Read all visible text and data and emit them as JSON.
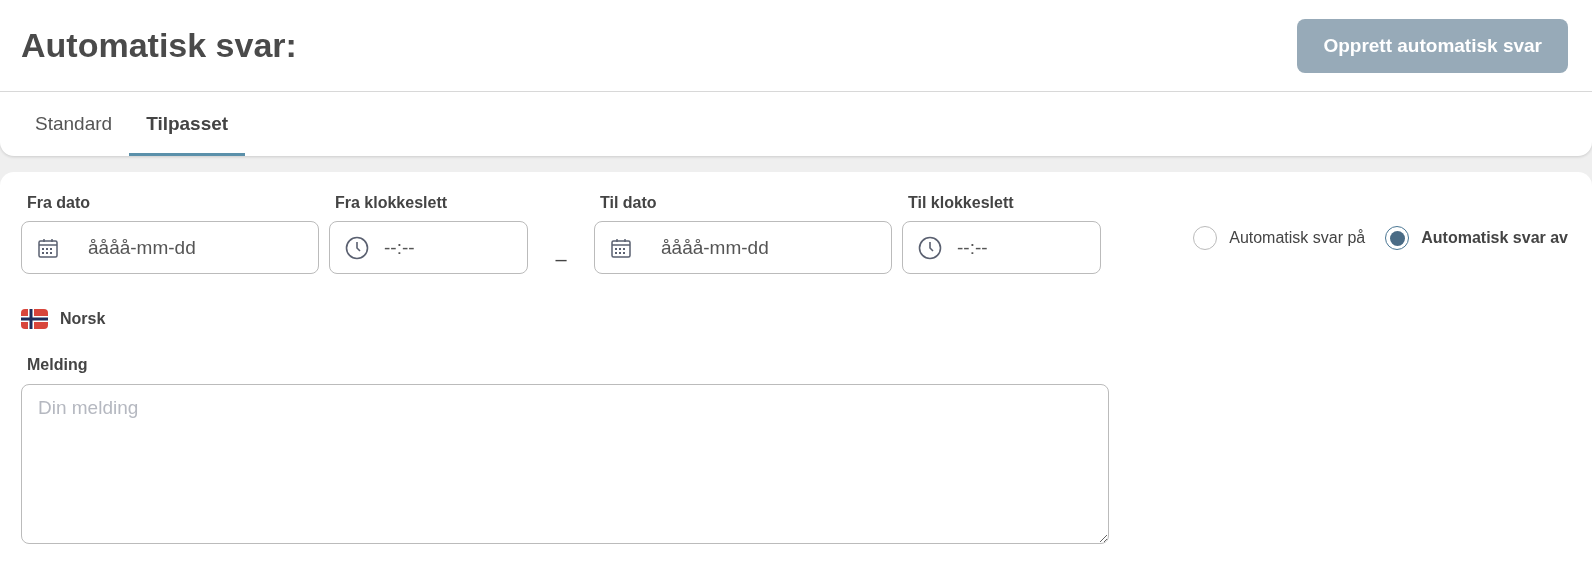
{
  "header": {
    "title": "Automatisk svar:",
    "create_button": {
      "label": "Opprett automatisk svar",
      "disabled": true
    }
  },
  "tabs": [
    {
      "label": "Standard",
      "selected": false
    },
    {
      "label": "Tilpasset",
      "selected": true
    }
  ],
  "fields": [
    {
      "label": "Fra dato",
      "kind": "date",
      "placeholder": "åååå-mm-dd"
    },
    {
      "label": "Fra klokkeslett",
      "kind": "time",
      "placeholder": "--:--"
    },
    {
      "label": "Til dato",
      "kind": "date",
      "placeholder": "åååå-mm-dd"
    },
    {
      "label": "Til klokkeslett",
      "kind": "time",
      "placeholder": "--:--"
    }
  ],
  "range_separator": "–",
  "radios": [
    {
      "label": "Automatisk svar på",
      "selected": false
    },
    {
      "label": "Automatisk svar av",
      "selected": true
    }
  ],
  "language": {
    "label": "Norsk"
  },
  "message": {
    "label": "Melding",
    "placeholder": "Din melding"
  }
}
